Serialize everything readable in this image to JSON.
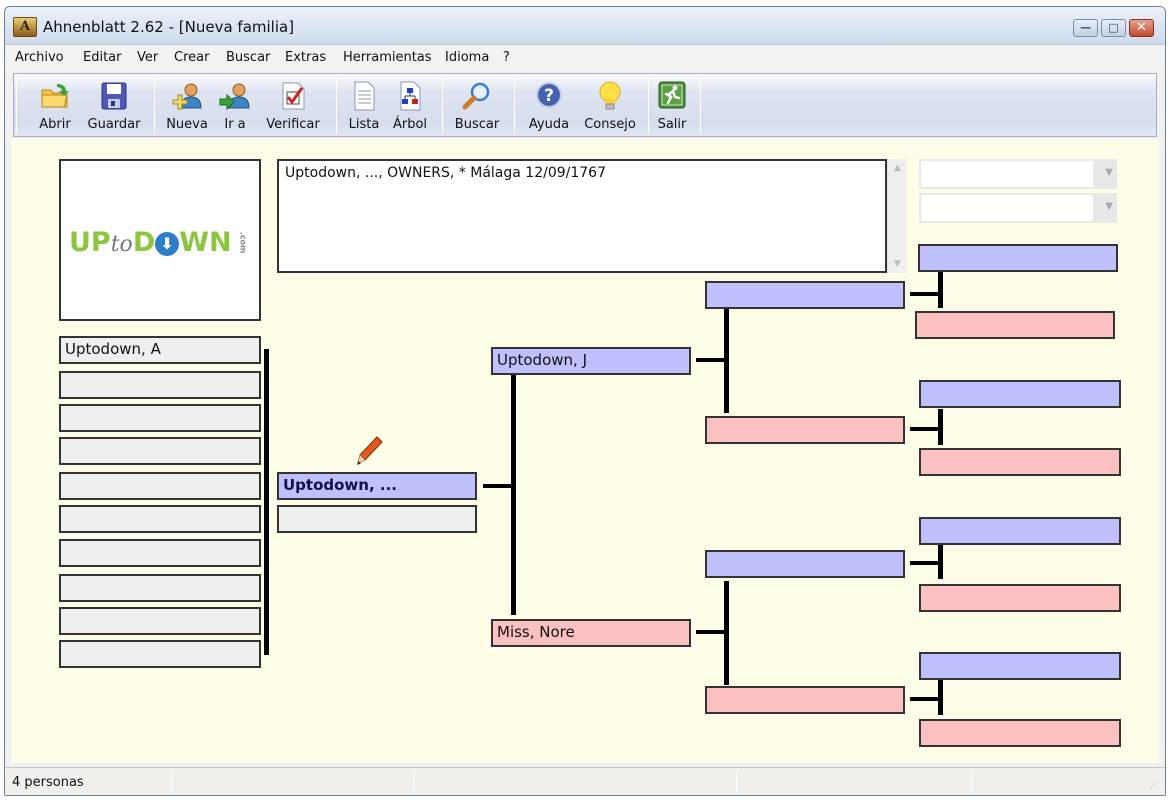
{
  "window": {
    "title": "Ahnenblatt 2.62 - [Nueva familia]",
    "app_icon_glyph": "A",
    "minimize_glyph": "—",
    "maximize_glyph": "□",
    "close_glyph": "✕"
  },
  "menu": [
    "Archivo",
    "Editar",
    "Ver",
    "Crear",
    "Buscar",
    "Extras",
    "Herramientas",
    "Idioma",
    "?"
  ],
  "toolbar": [
    {
      "label": "Abrir",
      "icon": "open-folder-icon"
    },
    {
      "label": "Guardar",
      "icon": "save-disk-icon"
    },
    {
      "label": "Nueva",
      "icon": "new-person-icon"
    },
    {
      "label": "Ir a",
      "icon": "goto-person-icon"
    },
    {
      "label": "Verificar",
      "icon": "verify-check-icon"
    },
    {
      "label": "Lista",
      "icon": "list-document-icon"
    },
    {
      "label": "Árbol",
      "icon": "tree-chart-icon"
    },
    {
      "label": "Buscar",
      "icon": "magnifier-icon"
    },
    {
      "label": "Ayuda",
      "icon": "help-icon"
    },
    {
      "label": "Consejo",
      "icon": "lightbulb-icon"
    },
    {
      "label": "Salir",
      "icon": "exit-icon"
    }
  ],
  "photo": {
    "logo_up": "UP",
    "logo_to": "to",
    "logo_d": "D",
    "logo_o": "⬇",
    "logo_wn": "WN",
    "logo_com": ".com"
  },
  "notes_text": "Uptodown, ..., OWNERS, * Málaga 12/09/1767",
  "scroll": {
    "up": "▲",
    "down": "▼"
  },
  "combos": [
    {
      "value": "",
      "arrow": "▼"
    },
    {
      "value": "",
      "arrow": "▼"
    }
  ],
  "children": [
    "Uptodown, A",
    "",
    "",
    "",
    "",
    "",
    "",
    "",
    "",
    ""
  ],
  "focus_person": {
    "name": "Uptodown, ...",
    "spouse": ""
  },
  "parents": {
    "father": "Uptodown, J",
    "mother": "Miss, Nore"
  },
  "grandparents": {
    "paternal_father": "",
    "paternal_mother": "",
    "maternal_father": "",
    "maternal_mother": ""
  },
  "great_grandparents": [
    "",
    "",
    "",
    "",
    "",
    "",
    "",
    ""
  ],
  "colors": {
    "male": "#c0c0fe",
    "female": "#fcc0c0",
    "empty": "#efefef",
    "background": "#fefee8"
  },
  "status": {
    "count": "4 personas",
    "cell2": "",
    "cell3": "",
    "cell4": "",
    "cell5": ""
  }
}
